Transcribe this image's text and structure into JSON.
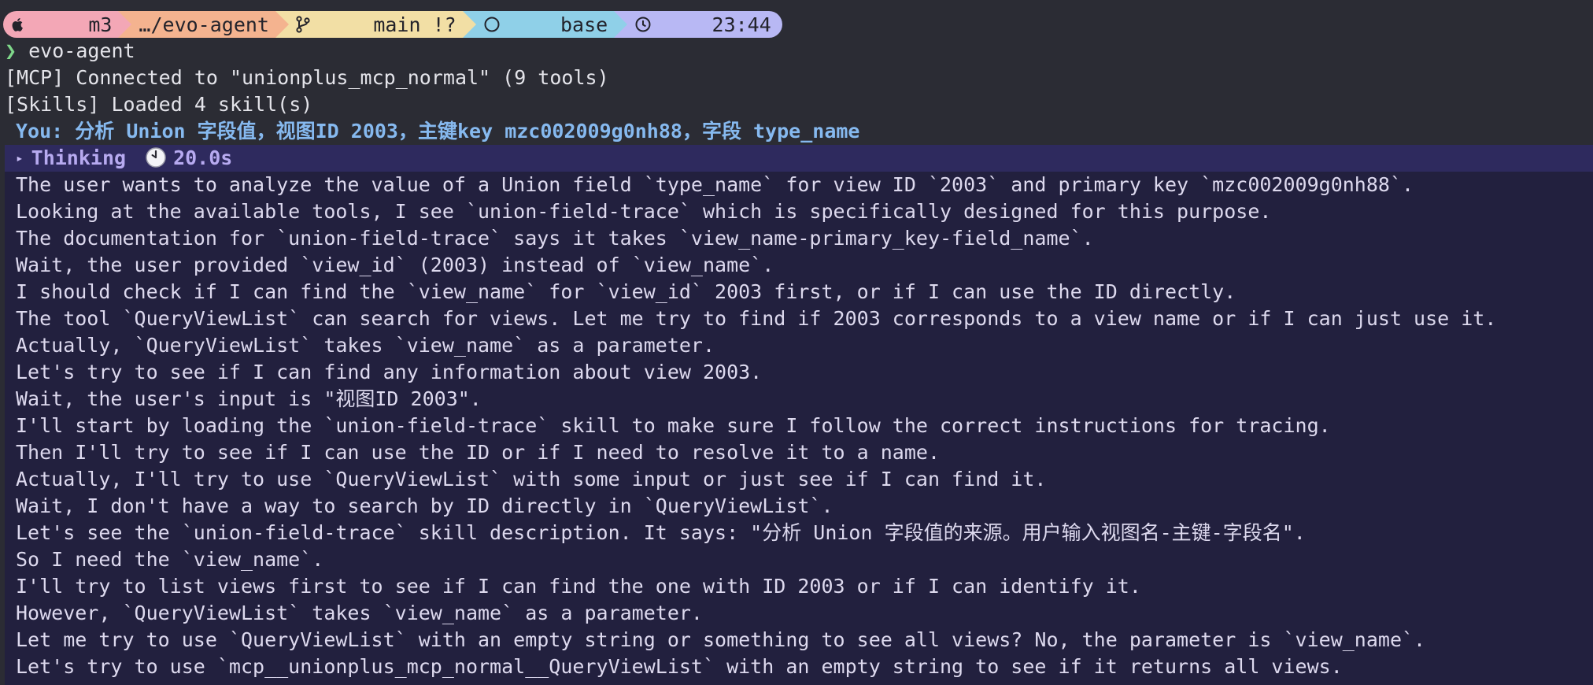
{
  "prompt_bar": {
    "segments": [
      {
        "name": "os",
        "icon": "apple-icon",
        "label": "m3",
        "color": "#f3a7b6"
      },
      {
        "name": "path",
        "icon": "",
        "label": "…/evo-agent",
        "color": "#f4b38f"
      },
      {
        "name": "git",
        "icon": "git-branch-icon",
        "label": "main !?",
        "color": "#f2dfa5"
      },
      {
        "name": "env",
        "icon": "circle-icon",
        "label": "base",
        "color": "#8fd0e8"
      },
      {
        "name": "time",
        "icon": "clock-icon",
        "label": "23:44",
        "color": "#b8b8f4"
      }
    ]
  },
  "terminal": {
    "command_prompt": "❯",
    "command": "evo-agent",
    "mcp_line": "[MCP] Connected to \"unionplus_mcp_normal\" (9 tools)",
    "skills_line": "[Skills] Loaded 4 skill(s)",
    "you_prefix": "You: ",
    "you_message": "分析 Union 字段值，视图ID 2003，主键key mzc002009g0nh88，字段 type_name"
  },
  "thinking": {
    "toggle": "▸",
    "label": "Thinking",
    "duration": "20.0s",
    "lines": [
      "The user wants to analyze the value of a Union field `type_name` for view ID `2003` and primary key `mzc002009g0nh88`.",
      "Looking at the available tools, I see `union-field-trace` which is specifically designed for this purpose.",
      "The documentation for `union-field-trace` says it takes `view_name-primary_key-field_name`.",
      "Wait, the user provided `view_id` (2003) instead of `view_name`.",
      "I should check if I can find the `view_name` for `view_id` 2003 first, or if I can use the ID directly.",
      "The tool `QueryViewList` can search for views. Let me try to find if 2003 corresponds to a view name or if I can just use it.",
      "Actually, `QueryViewList` takes `view_name` as a parameter.",
      "Let's try to see if I can find any information about view 2003.",
      "Wait, the user's input is \"视图ID 2003\".",
      "I'll start by loading the `union-field-trace` skill to make sure I follow the correct instructions for tracing.",
      "Then I'll try to see if I can use the ID or if I need to resolve it to a name.",
      "Actually, I'll try to use `QueryViewList` with some input or just see if I can find it.",
      "Wait, I don't have a way to search by ID directly in `QueryViewList`.",
      "Let's see the `union-field-trace` skill description. It says: \"分析 Union 字段值的来源。用户输入视图名-主键-字段名\".",
      "So I need the `view_name`.",
      "I'll try to list views first to see if I can find the one with ID 2003 or if I can identify it.",
      "However, `QueryViewList` takes `view_name` as a parameter.",
      "Let me try to use `QueryViewList` with an empty string or something to see all views? No, the parameter is `view_name`.",
      "Let's try to use `mcp__unionplus_mcp_normal__QueryViewList` with an empty string to see if it returns all views."
    ]
  }
}
